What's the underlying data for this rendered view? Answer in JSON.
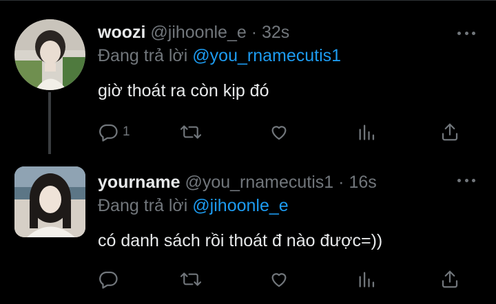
{
  "tweets": [
    {
      "display_name": "woozi",
      "handle": "@jihoonle_e",
      "separator": "·",
      "time": "32s",
      "reply_prefix": "Đang trả lời",
      "reply_to": "@you_rnamecutis1",
      "text": "giờ thoát ra còn kịp đó",
      "reply_count": "1",
      "icons": [
        "reply-icon",
        "retweet-icon",
        "like-icon",
        "views-icon",
        "share-icon",
        "more-icon"
      ]
    },
    {
      "display_name": "yourname",
      "handle": "@you_rnamecutis1",
      "separator": "·",
      "time": "16s",
      "reply_prefix": "Đang trả lời",
      "reply_to": "@jihoonle_e",
      "text": "có danh sách rồi thoát đ nào được=))",
      "reply_count": "",
      "icons": [
        "reply-icon",
        "retweet-icon",
        "like-icon",
        "views-icon",
        "share-icon",
        "more-icon"
      ]
    }
  ],
  "colors": {
    "background": "#000000",
    "text": "#e7e9ea",
    "secondary": "#71767b",
    "link": "#1d9bf0",
    "thread_line": "#3a3d40"
  }
}
